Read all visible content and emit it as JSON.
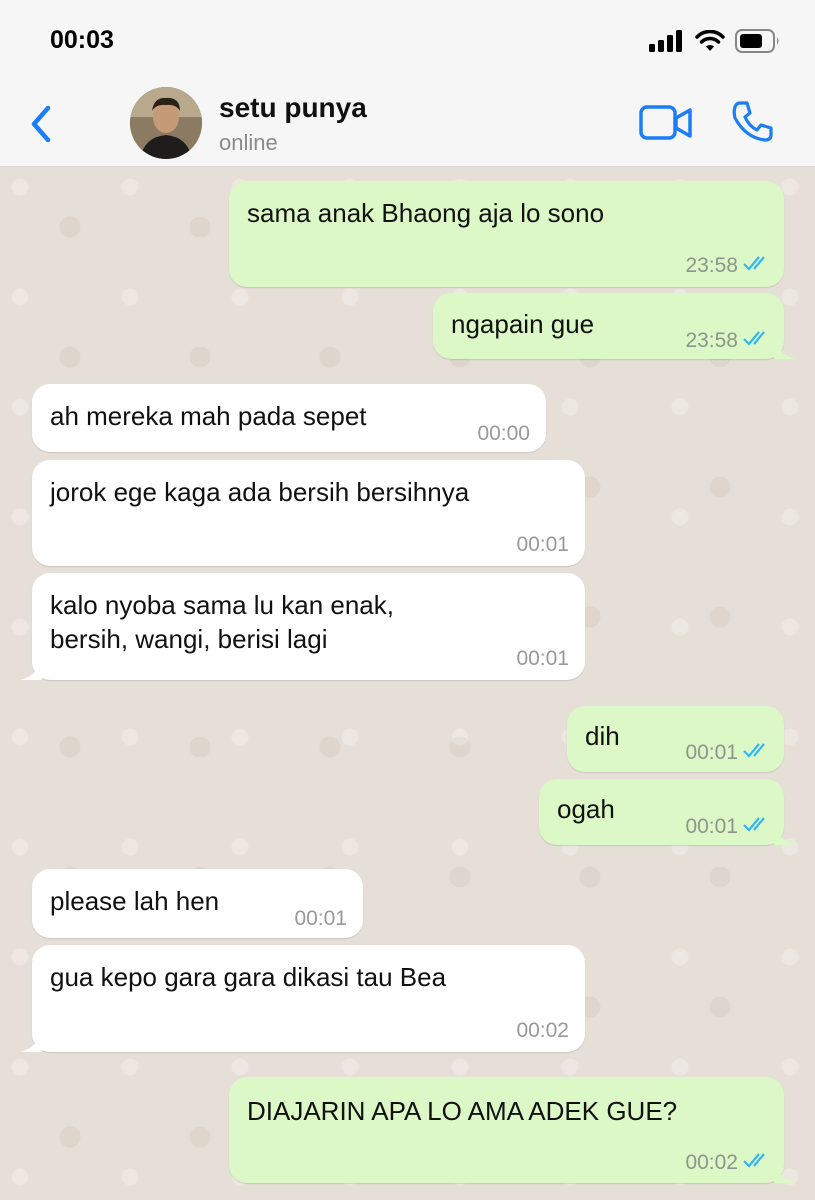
{
  "status_bar": {
    "time": "00:03"
  },
  "header": {
    "contact_name": "setu punya",
    "contact_status": "online"
  },
  "colors": {
    "accent": "#1b7ef5",
    "outgoing_bubble": "#dcf8c6",
    "incoming_bubble": "#ffffff",
    "read_ticks": "#34b7f1"
  },
  "messages": [
    {
      "direction": "out",
      "text": "sama anak Bhaong aja lo sono",
      "time": "23:58",
      "read": true
    },
    {
      "direction": "out",
      "text": "ngapain gue",
      "time": "23:58",
      "read": true
    },
    {
      "direction": "in",
      "text": "ah mereka mah pada sepet",
      "time": "00:00"
    },
    {
      "direction": "in",
      "text": "jorok ege kaga ada bersih bersihnya",
      "time": "00:01"
    },
    {
      "direction": "in",
      "text": "kalo nyoba sama lu kan enak,\nbersih, wangi, berisi lagi",
      "time": "00:01"
    },
    {
      "direction": "out",
      "text": "dih",
      "time": "00:01",
      "read": true
    },
    {
      "direction": "out",
      "text": "ogah",
      "time": "00:01",
      "read": true
    },
    {
      "direction": "in",
      "text": "please lah hen",
      "time": "00:01"
    },
    {
      "direction": "in",
      "text": "gua kepo gara gara dikasi tau Bea",
      "time": "00:02"
    },
    {
      "direction": "out",
      "text": "DIAJARIN APA LO AMA ADEK GUE?",
      "time": "00:02",
      "read": true
    }
  ]
}
